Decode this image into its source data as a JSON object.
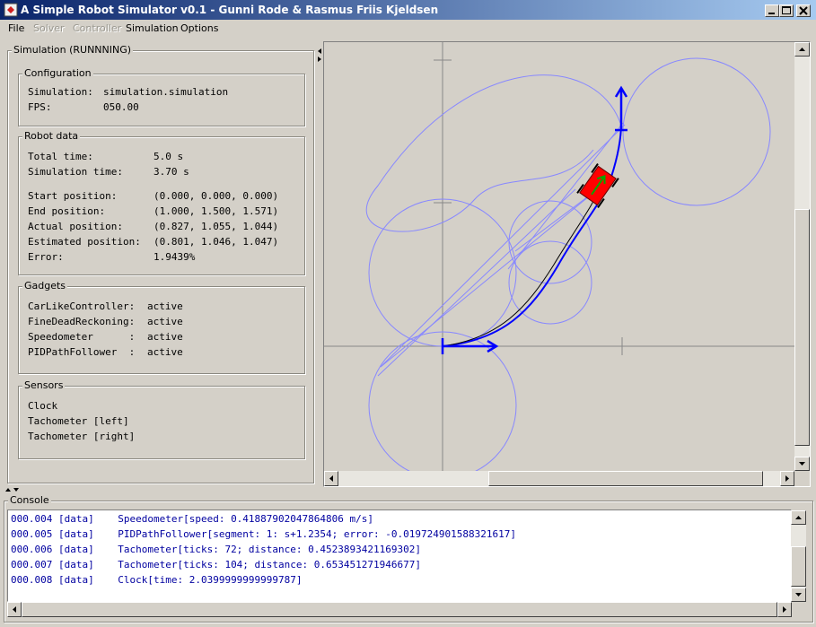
{
  "window": {
    "title": "A Simple Robot Simulator v0.1 - Gunni Rode & Rasmus Friis Kjeldsen"
  },
  "menu": {
    "file": "File",
    "solver": "Solver",
    "controller": "Controller",
    "simulation": "Simulation",
    "options": "Options"
  },
  "simulation_panel": {
    "title": "Simulation (RUNNNING)",
    "configuration": {
      "title": "Configuration",
      "rows": [
        {
          "label": "Simulation:",
          "value": "simulation.simulation"
        },
        {
          "label": "FPS:",
          "value": "050.00"
        }
      ]
    },
    "robot_data": {
      "title": "Robot data",
      "rows": [
        {
          "label": "Total time:",
          "value": "5.0 s"
        },
        {
          "label": "Simulation time:",
          "value": "3.70 s"
        },
        {
          "label": "Start position:",
          "value": "(0.000, 0.000, 0.000)"
        },
        {
          "label": "End position:",
          "value": "(1.000, 1.500, 1.571)"
        },
        {
          "label": "Actual position:",
          "value": "(0.827, 1.055, 1.044)"
        },
        {
          "label": "Estimated position:",
          "value": "(0.801, 1.046, 1.047)"
        },
        {
          "label": "Error:",
          "value": "1.9439%"
        }
      ]
    },
    "gadgets": {
      "title": "Gadgets",
      "rows": [
        {
          "label": "CarLikeController:",
          "value": "active"
        },
        {
          "label": "FineDeadReckoning:",
          "value": "active"
        },
        {
          "label": "Speedometer      :",
          "value": "active"
        },
        {
          "label": "PIDPathFollower  :",
          "value": "active"
        }
      ]
    },
    "sensors": {
      "title": "Sensors",
      "items": [
        "Clock",
        "Tachometer [left]",
        "Tachometer [right]"
      ]
    }
  },
  "console": {
    "title": "Console",
    "lines": [
      {
        "time": "000.004",
        "tag": "[data]",
        "text": "Speedometer[speed: 0.41887902047864806 m/s]"
      },
      {
        "time": "000.005",
        "tag": "[data]",
        "text": "PIDPathFollower[segment: 1: s+1.2354; error: -0.019724901588321617]"
      },
      {
        "time": "000.006",
        "tag": "[data]",
        "text": "Tachometer[ticks: 72; distance: 0.4523893421169302]"
      },
      {
        "time": "000.007",
        "tag": "[data]",
        "text": "Tachometer[ticks: 104; distance: 0.653451271946677]"
      },
      {
        "time": "000.008",
        "tag": "[data]",
        "text": "Clock[time: 2.0399999999999787]"
      }
    ]
  },
  "colors": {
    "path": "#0000ff",
    "circles": "#8888ff",
    "robot_body": "#ff0000",
    "trace": "#000000"
  }
}
